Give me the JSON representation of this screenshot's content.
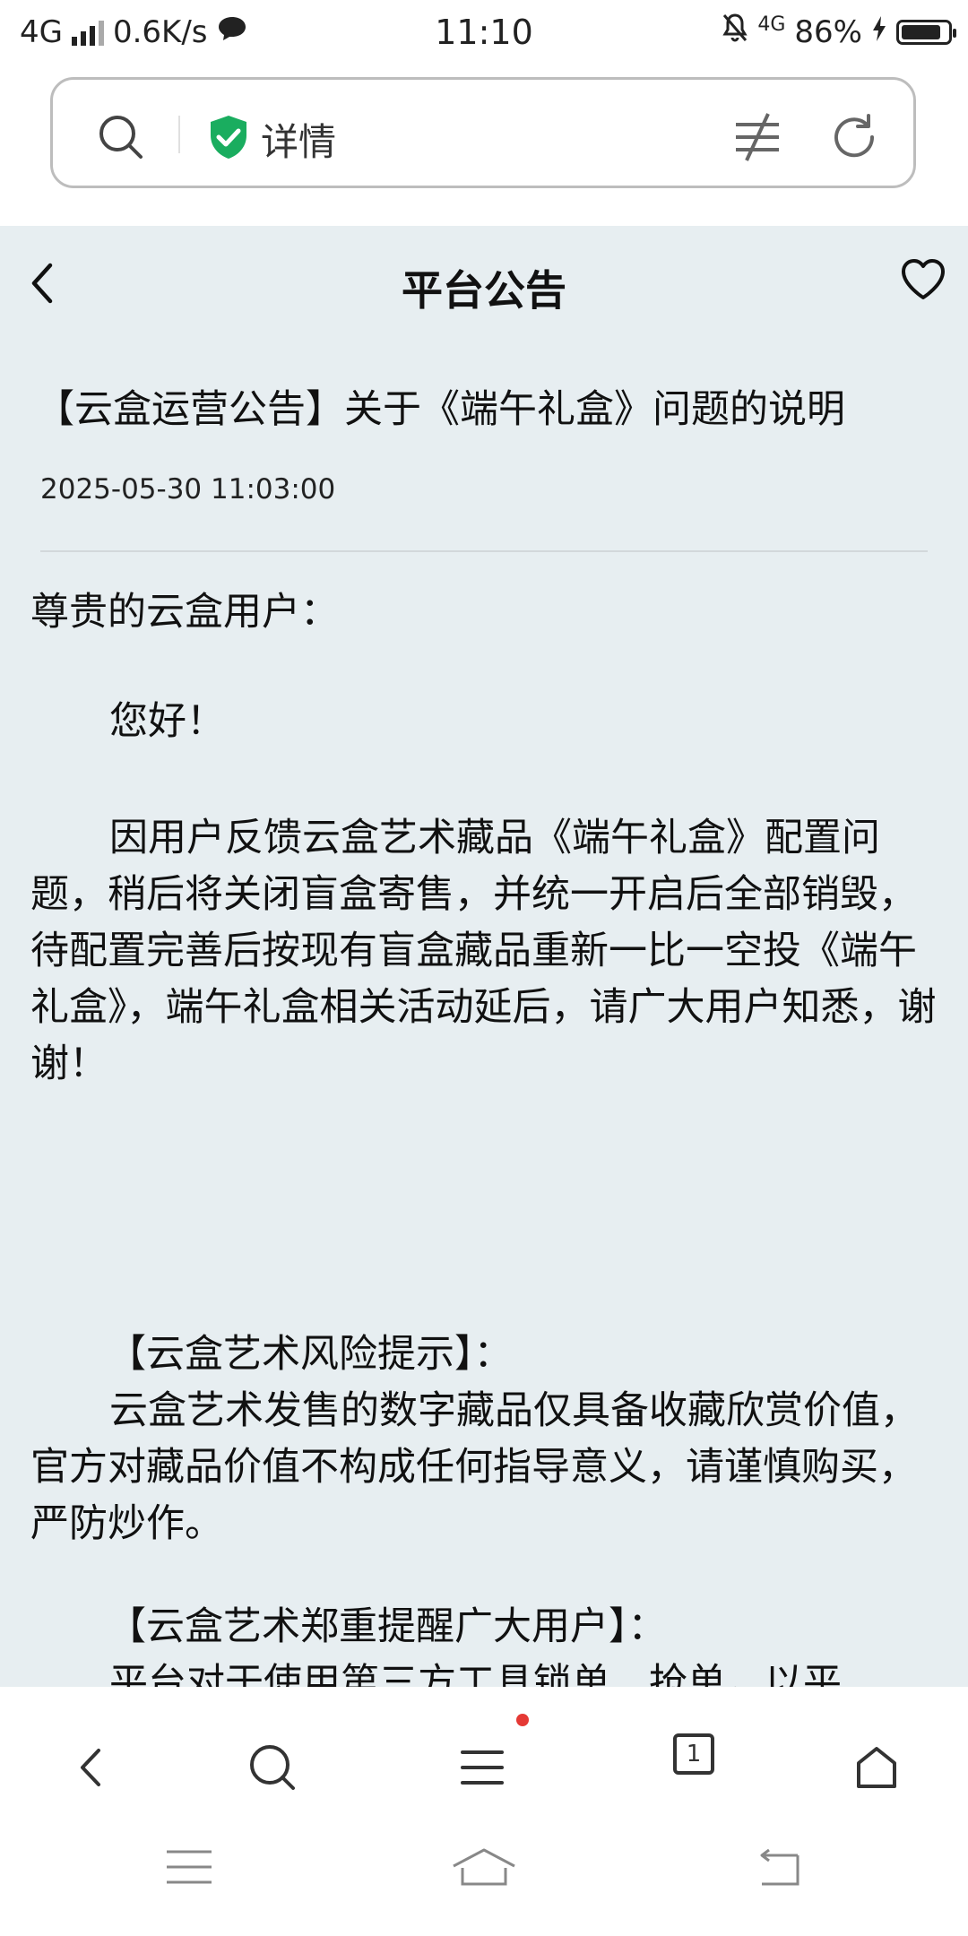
{
  "status_bar": {
    "network": "4G",
    "speed": "0.6K/s",
    "time": "11:10",
    "net_small": "4G",
    "battery_percent_text": "86%",
    "battery_level": 0.86
  },
  "address_bar": {
    "label": "详情",
    "shield_color": "#1aad5f"
  },
  "nav": {
    "title": "平台公告"
  },
  "article": {
    "title": "【云盒运营公告】关于《端午礼盒》问题的说明",
    "date": "2025-05-30 11:03:00",
    "greeting": "尊贵的云盒用户：",
    "hello": "您好！",
    "para1": "因用户反馈云盒艺术藏品《端午礼盒》配置问题，稍后将关闭盲盒寄售，并统一开启后全部销毁，待配置完善后按现有盲盒藏品重新一比一空投《端午礼盒》，端午礼盒相关活动延后，请广大用户知悉，谢谢！",
    "risk_heading": "【云盒艺术风险提示】：",
    "risk_text": "云盒艺术发售的数字藏品仅具备收藏欣赏价值，官方对藏品价值不构成任何指导意义，请谨慎购买，严防炒作。",
    "remind_heading": "【云盒艺术郑重提醒广大用户】：",
    "remind_text_partial": "平台对于使用第三方工具锁单、抢单，以平"
  },
  "bottom_nav": {
    "tab_count": "1"
  },
  "colors": {
    "content_bg": "#e7eef1",
    "notification_dot": "#e53935"
  }
}
